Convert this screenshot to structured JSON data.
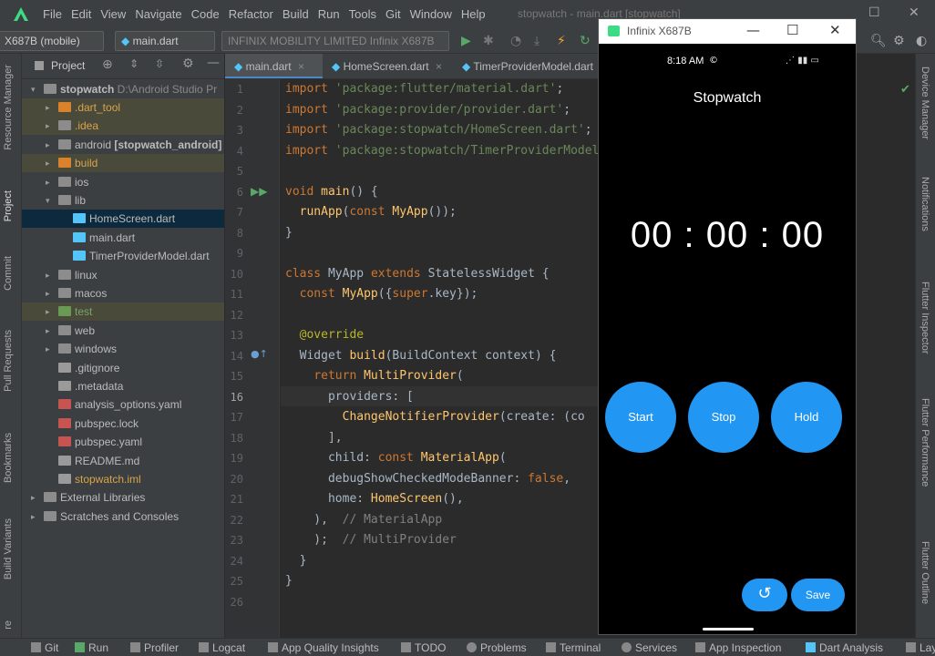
{
  "menu": [
    "File",
    "Edit",
    "View",
    "Navigate",
    "Code",
    "Refactor",
    "Build",
    "Run",
    "Tools",
    "Git",
    "Window",
    "Help"
  ],
  "window_title": "stopwatch - main.dart [stopwatch]",
  "toolbar": {
    "device": "X687B (mobile)",
    "config": "main.dart",
    "device_full": "INFINIX MOBILITY LIMITED Infinix X687B"
  },
  "left_tools": [
    "Resource Manager",
    "Project",
    "Commit",
    "Pull Requests",
    "Bookmarks",
    "Build Variants",
    "re"
  ],
  "project_panel": {
    "title": "Project",
    "tree": [
      {
        "label": "stopwatch",
        "suffix": "D:\\Android Studio Pr",
        "depth": 0,
        "arrow": "▾",
        "icon": "folder"
      },
      {
        "label": ".dart_tool",
        "depth": 1,
        "arrow": "▸",
        "icon": "folder-orange",
        "style": "excluded"
      },
      {
        "label": ".idea",
        "depth": 1,
        "arrow": "▸",
        "icon": "folder",
        "style": "excluded"
      },
      {
        "label": "android",
        "suffix": "[stopwatch_android]",
        "depth": 1,
        "arrow": "▸",
        "icon": "folder"
      },
      {
        "label": "build",
        "depth": 1,
        "arrow": "▸",
        "icon": "folder-orange",
        "style": "excluded"
      },
      {
        "label": "ios",
        "depth": 1,
        "arrow": "▸",
        "icon": "folder"
      },
      {
        "label": "lib",
        "depth": 1,
        "arrow": "▾",
        "icon": "folder"
      },
      {
        "label": "HomeScreen.dart",
        "depth": 2,
        "icon": "dart",
        "style": "selected"
      },
      {
        "label": "main.dart",
        "depth": 2,
        "icon": "dart"
      },
      {
        "label": "TimerProviderModel.dart",
        "depth": 2,
        "icon": "dart"
      },
      {
        "label": "linux",
        "depth": 1,
        "arrow": "▸",
        "icon": "folder"
      },
      {
        "label": "macos",
        "depth": 1,
        "arrow": "▸",
        "icon": "folder"
      },
      {
        "label": "test",
        "depth": 1,
        "arrow": "▸",
        "icon": "folder-green",
        "style": "excluded"
      },
      {
        "label": "web",
        "depth": 1,
        "arrow": "▸",
        "icon": "folder"
      },
      {
        "label": "windows",
        "depth": 1,
        "arrow": "▸",
        "icon": "folder"
      },
      {
        "label": ".gitignore",
        "depth": 1,
        "icon": "file"
      },
      {
        "label": ".metadata",
        "depth": 1,
        "icon": "file"
      },
      {
        "label": "analysis_options.yaml",
        "depth": 1,
        "icon": "yaml"
      },
      {
        "label": "pubspec.lock",
        "depth": 1,
        "icon": "yaml"
      },
      {
        "label": "pubspec.yaml",
        "depth": 1,
        "icon": "yaml"
      },
      {
        "label": "README.md",
        "depth": 1,
        "icon": "md"
      },
      {
        "label": "stopwatch.iml",
        "depth": 1,
        "icon": "iml",
        "style": "iml"
      },
      {
        "label": "External Libraries",
        "depth": 0,
        "arrow": "▸",
        "icon": "lib"
      },
      {
        "label": "Scratches and Consoles",
        "depth": 0,
        "arrow": "▸",
        "icon": "scratch"
      }
    ]
  },
  "editor_tabs": [
    "main.dart",
    "HomeScreen.dart",
    "TimerProviderModel.dart"
  ],
  "code_lines": [
    [
      [
        "kw",
        "import "
      ],
      [
        "str",
        "'package:flutter/material.dart'"
      ],
      [
        "",
        ";"
      ]
    ],
    [
      [
        "kw",
        "import "
      ],
      [
        "str",
        "'package:provider/provider.dart'"
      ],
      [
        "",
        ";"
      ]
    ],
    [
      [
        "kw",
        "import "
      ],
      [
        "str",
        "'package:stopwatch/HomeScreen.dart'"
      ],
      [
        "",
        ";"
      ]
    ],
    [
      [
        "kw",
        "import "
      ],
      [
        "str",
        "'package:stopwatch/TimerProviderModel.dart'"
      ],
      [
        "",
        ";"
      ]
    ],
    [],
    [
      [
        "kw",
        "void "
      ],
      [
        "fn",
        "main"
      ],
      [
        "",
        "() {"
      ]
    ],
    [
      [
        "",
        "  "
      ],
      [
        "fn",
        "runApp"
      ],
      [
        "",
        "("
      ],
      [
        "kw",
        "const "
      ],
      [
        "fn",
        "MyApp"
      ],
      [
        "",
        "());"
      ]
    ],
    [
      [
        "",
        "}"
      ]
    ],
    [],
    [
      [
        "kw",
        "class "
      ],
      [
        "",
        "MyApp "
      ],
      [
        "kw",
        "extends "
      ],
      [
        "",
        "StatelessWidget {"
      ]
    ],
    [
      [
        "",
        "  "
      ],
      [
        "kw",
        "const "
      ],
      [
        "fn",
        "MyApp"
      ],
      [
        "",
        "({"
      ],
      [
        "kw",
        "super"
      ],
      [
        "",
        ".key});"
      ]
    ],
    [],
    [
      [
        "",
        "  "
      ],
      [
        "ann",
        "@override"
      ]
    ],
    [
      [
        "",
        "  Widget "
      ],
      [
        "fn",
        "build"
      ],
      [
        "",
        "(BuildContext context) {"
      ]
    ],
    [
      [
        "",
        "    "
      ],
      [
        "kw",
        "return "
      ],
      [
        "fn",
        "MultiProvider"
      ],
      [
        "",
        "("
      ]
    ],
    [
      [
        "",
        "      providers: ["
      ]
    ],
    [
      [
        "",
        "        "
      ],
      [
        "fn",
        "ChangeNotifierProvider"
      ],
      [
        "",
        "(create: (co"
      ]
    ],
    [
      [
        "",
        "      ],"
      ]
    ],
    [
      [
        "",
        "      child: "
      ],
      [
        "kw",
        "const "
      ],
      [
        "fn",
        "MaterialApp"
      ],
      [
        "",
        "("
      ]
    ],
    [
      [
        "",
        "      debugShowCheckedModeBanner: "
      ],
      [
        "kw",
        "false"
      ],
      [
        "",
        ","
      ]
    ],
    [
      [
        "",
        "      home: "
      ],
      [
        "fn",
        "HomeScreen"
      ],
      [
        "",
        "(),"
      ]
    ],
    [
      [
        "",
        "    ),  "
      ],
      [
        "cmt",
        "// MaterialApp"
      ]
    ],
    [
      [
        "",
        "    );  "
      ],
      [
        "cmt",
        "// MultiProvider"
      ]
    ],
    [
      [
        "",
        "  }"
      ]
    ],
    [
      [
        "",
        "}"
      ]
    ],
    []
  ],
  "emulator": {
    "title": "Infinix X687B",
    "status_time": "8:18 AM",
    "app_title": "Stopwatch",
    "timer": "00 : 00 : 00",
    "buttons": [
      "Start",
      "Stop",
      "Hold"
    ],
    "save_label": "Save",
    "accent": "#2196f3"
  },
  "right_tools": [
    "Device Manager",
    "Notifications",
    "Flutter Inspector",
    "Flutter Performance",
    "Flutter Outline"
  ],
  "bottom_tools": [
    "Git",
    "Run",
    "Profiler",
    "Logcat",
    "App Quality Insights",
    "TODO",
    "Problems",
    "Terminal",
    "Services",
    "App Inspection",
    "Dart Analysis",
    "Lay"
  ]
}
